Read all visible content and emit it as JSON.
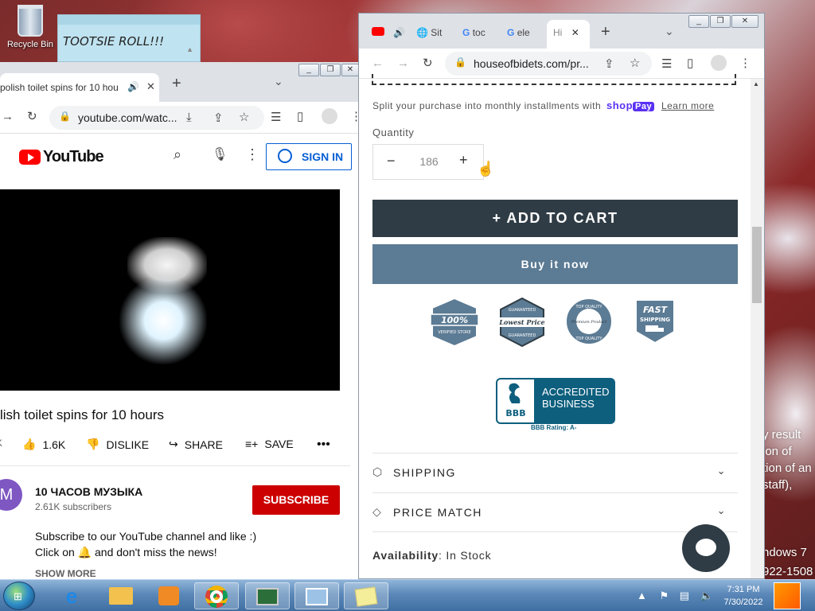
{
  "desktop": {
    "recycle_bin_label": "Recycle Bin",
    "sticky_note_text": "TOOTSIE ROLL!!!",
    "background_text_lines": [
      "y result",
      "ion of",
      "tion of an",
      "staff),"
    ],
    "windows_text": "ndows 7",
    "build_text": "922-1508"
  },
  "youtube_window": {
    "tab_title": "polish toilet spins for 10 hou",
    "address": "youtube.com/watc...",
    "sign_in_label": "SIGN IN",
    "logo_text": "YouTube",
    "video_title": "lish toilet spins for 10 hours",
    "likes": "1.6K",
    "dislike_label": "DISLIKE",
    "share_label": "SHARE",
    "save_label": "SAVE",
    "left_edge_char": "K",
    "channel_initial": "M",
    "channel_name": "10 ЧАСОВ МУЗЫКА",
    "subscribers": "2.61K subscribers",
    "subscribe_label": "SUBSCRIBE",
    "description_line1": "Subscribe to our YouTube channel and like :)",
    "description_line2": "Click on 🔔 and don't miss the news!",
    "show_more": "SHOW MORE"
  },
  "shop_window": {
    "tabs": [
      {
        "label": "Sit"
      },
      {
        "label": "toc"
      },
      {
        "label": "ele"
      },
      {
        "label": "Hi"
      }
    ],
    "address": "houseofbidets.com/pr...",
    "split_text": "Split your purchase into monthly installments with",
    "shop_pay_brand": "shop",
    "shop_pay_pay": "Pay",
    "learn_more": "Learn more",
    "quantity_label": "Quantity",
    "quantity_value": "186",
    "add_to_cart": "ADD TO CART",
    "buy_now": "Buy it now",
    "badges": [
      {
        "top": "100%",
        "bottom": "VERIFIED STORE"
      },
      {
        "top": "GUARANTEED",
        "middle": "Lowest Price",
        "bottom": "GUARANTEED"
      },
      {
        "top": "TOP QUALITY",
        "middle": "Premium Product",
        "bottom": "TOP QUALITY"
      },
      {
        "top": "FAST",
        "bottom": "SHIPPING"
      }
    ],
    "bbb_line1": "ACCREDITED",
    "bbb_line2": "BUSINESS",
    "bbb_logo": "BBB",
    "bbb_rating": "BBB Rating: A-",
    "shipping_label": "SHIPPING",
    "price_match_label": "PRICE MATCH",
    "availability_label": "Availability",
    "availability_value": "In Stock"
  },
  "taskbar": {
    "time": "7:31 PM",
    "date": "7/30/2022"
  },
  "colors": {
    "youtube_red": "#ff0000",
    "subscribe_red": "#cc0000",
    "cart_dark": "#2f3c45",
    "buy_blue": "#5c7b94",
    "shop_pay_purple": "#5a31f4",
    "bbb_blue": "#0e5f7e"
  }
}
